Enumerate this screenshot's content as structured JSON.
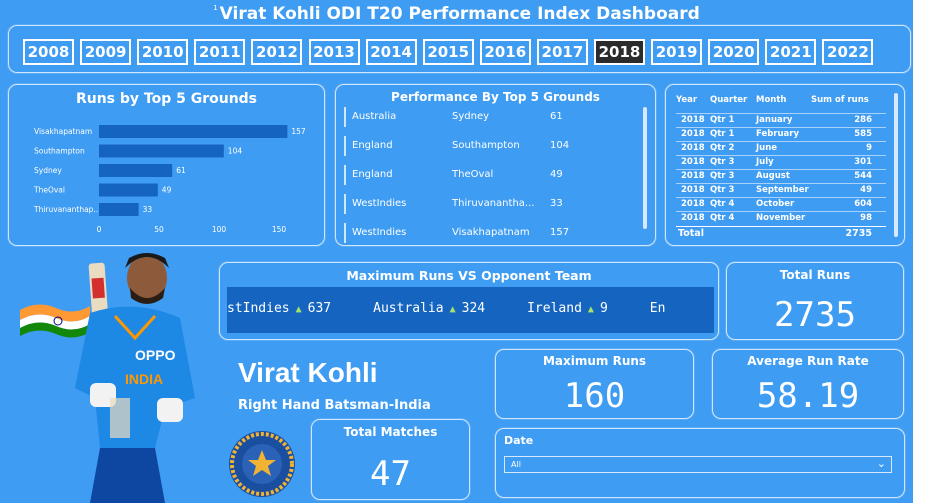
{
  "title": "Virat Kohli ODI T20 Performance Index Dashboard",
  "title_marker": "1",
  "years": [
    "2008",
    "2009",
    "2010",
    "2011",
    "2012",
    "2013",
    "2014",
    "2015",
    "2016",
    "2017",
    "2018",
    "2019",
    "2020",
    "2021",
    "2022"
  ],
  "selected_year": "2018",
  "grounds_chart": {
    "title": "Runs by Top 5 Grounds",
    "chart_data": {
      "type": "bar",
      "categories": [
        "Visakhapatnam",
        "Southampton",
        "Sydney",
        "TheOval",
        "Thiruvananthap..."
      ],
      "values": [
        157,
        104,
        61,
        49,
        33
      ],
      "value_labels": [
        "157",
        "104",
        "61",
        "49",
        "33"
      ],
      "xlim": [
        0,
        175
      ],
      "xticks": [
        "0",
        "50",
        "100",
        "150"
      ],
      "colors": {
        "bar": "#1565c0"
      }
    }
  },
  "performance": {
    "title": "Performance By Top 5 Grounds",
    "rows": [
      {
        "country": "Australia",
        "ground": "Sydney",
        "runs": "61"
      },
      {
        "country": "England",
        "ground": "Southampton",
        "runs": "104"
      },
      {
        "country": "England",
        "ground": "TheOval",
        "runs": "49"
      },
      {
        "country": "WestIndies",
        "ground": "Thiruvanantha...",
        "runs": "33"
      },
      {
        "country": "WestIndies",
        "ground": "Visakhapatnam",
        "runs": "157"
      }
    ]
  },
  "matrix": {
    "headers": [
      "Year",
      "Quarter",
      "Month",
      "Sum of runs"
    ],
    "rows": [
      {
        "year": "2018",
        "quarter": "Qtr 1",
        "month": "January",
        "runs": "286"
      },
      {
        "year": "2018",
        "quarter": "Qtr 1",
        "month": "February",
        "runs": "585"
      },
      {
        "year": "2018",
        "quarter": "Qtr 2",
        "month": "June",
        "runs": "9"
      },
      {
        "year": "2018",
        "quarter": "Qtr 3",
        "month": "July",
        "runs": "301"
      },
      {
        "year": "2018",
        "quarter": "Qtr 3",
        "month": "August",
        "runs": "544"
      },
      {
        "year": "2018",
        "quarter": "Qtr 3",
        "month": "September",
        "runs": "49"
      },
      {
        "year": "2018",
        "quarter": "Qtr 4",
        "month": "October",
        "runs": "604"
      },
      {
        "year": "2018",
        "quarter": "Qtr 4",
        "month": "November",
        "runs": "98"
      }
    ],
    "total_label": "Total",
    "total_value": "2735"
  },
  "ticker": {
    "title": "Maximum Runs VS Opponent Team",
    "items": [
      {
        "team": "stIndies",
        "value": "637"
      },
      {
        "team": "Australia",
        "value": "324"
      },
      {
        "team": "Ireland",
        "value": "9"
      },
      {
        "team": "En",
        "value": ""
      }
    ],
    "arrow": "▲"
  },
  "kpis": {
    "total_runs": {
      "label": "Total Runs",
      "value": "2735"
    },
    "max_runs": {
      "label": "Maximum Runs",
      "value": "160"
    },
    "avg_run_rate": {
      "label": "Average Run Rate",
      "value": "58.19"
    },
    "total_matches": {
      "label": "Total Matches",
      "value": "47"
    }
  },
  "player": {
    "name": "Virat Kohli",
    "role": "Right Hand Batsman-India",
    "jersey_text": "OPPO",
    "jersey_text2": "INDIA"
  },
  "date_slicer": {
    "label": "Date",
    "selected": "All"
  },
  "colors": {
    "background": "#3f9cf3",
    "accent_dark": "#1565c0",
    "selected_year": "#2b2b2b"
  }
}
